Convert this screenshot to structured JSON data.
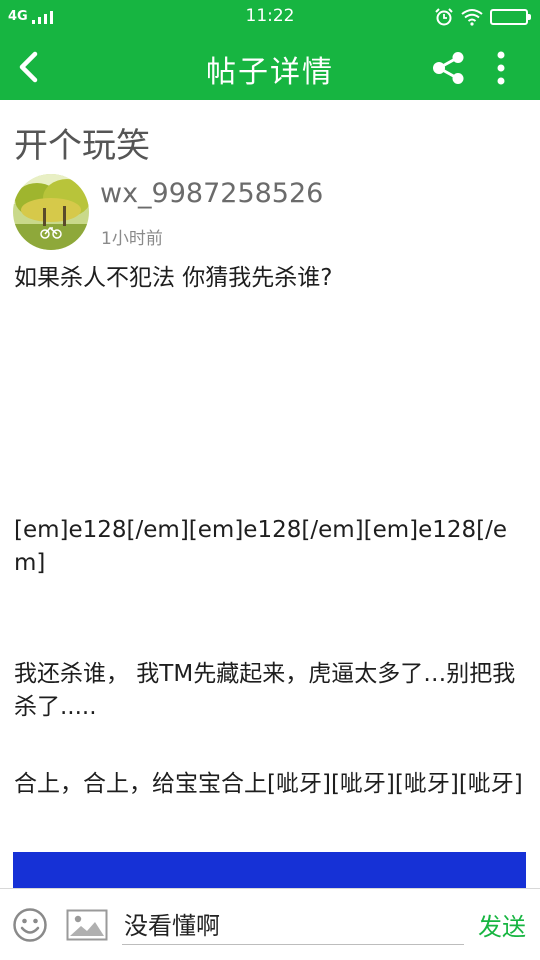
{
  "status_bar": {
    "network": "4G",
    "time": "11:22",
    "icons": [
      "signal-icon",
      "alarm-icon",
      "wifi-icon",
      "battery-icon"
    ]
  },
  "header": {
    "title": "帖子详情",
    "icons": [
      "back-icon",
      "share-icon",
      "more-icon"
    ]
  },
  "post": {
    "title": "开个玩笑",
    "author": "wx_9987258526",
    "time_ago": "1小时前",
    "paragraphs": [
      "如果杀人不犯法 你猜我先杀谁?",
      "[em]e128[/em][em]e128[/em][em]e128[/em]",
      "我还杀谁， 我TM先藏起来，虎逼太多了…别把我杀了.....",
      "合上，合上，给宝宝合上[呲牙][呲牙][呲牙][呲牙]"
    ]
  },
  "comment_bar": {
    "input_value": "没看懂啊",
    "send_label": "发送",
    "icons": [
      "emoji-icon",
      "image-icon"
    ]
  },
  "colors": {
    "brand_green": "#17b541",
    "image_blue": "#1631d6"
  }
}
